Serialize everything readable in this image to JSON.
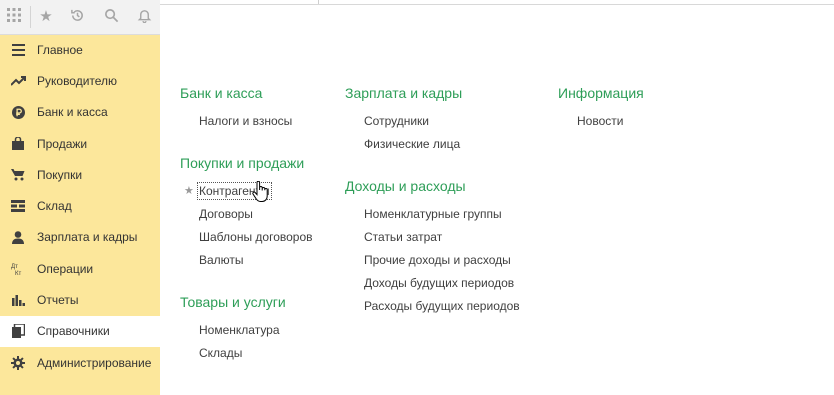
{
  "toolbar": {
    "icons": [
      "apps-grid-icon",
      "star-icon",
      "history-icon",
      "search-icon",
      "bell-icon"
    ]
  },
  "nav": {
    "items": [
      {
        "label": "Главное",
        "icon": "menu-lines-icon"
      },
      {
        "label": "Руководителю",
        "icon": "trend-up-icon"
      },
      {
        "label": "Банк и касса",
        "icon": "ruble-coin-icon"
      },
      {
        "label": "Продажи",
        "icon": "shopping-bag-icon"
      },
      {
        "label": "Покупки",
        "icon": "cart-icon"
      },
      {
        "label": "Склад",
        "icon": "warehouse-icon"
      },
      {
        "label": "Зарплата и кадры",
        "icon": "person-icon"
      },
      {
        "label": "Операции",
        "icon": "dt-kt-icon",
        "icon_text": "Дт\nКт"
      },
      {
        "label": "Отчеты",
        "icon": "bar-chart-icon"
      },
      {
        "label": "Справочники",
        "icon": "books-icon",
        "active": true
      },
      {
        "label": "Администрирование",
        "icon": "gear-icon"
      }
    ]
  },
  "sections": {
    "bank": {
      "title": "Банк и касса",
      "links": [
        "Налоги и взносы"
      ]
    },
    "purchases_sales": {
      "title": "Покупки и продажи",
      "links": [
        "Контрагенты",
        "Договоры",
        "Шаблоны договоров",
        "Валюты"
      ]
    },
    "goods": {
      "title": "Товары и услуги",
      "links": [
        "Номенклатура",
        "Склады"
      ]
    },
    "salary": {
      "title": "Зарплата и кадры",
      "links": [
        "Сотрудники",
        "Физические лица"
      ]
    },
    "income": {
      "title": "Доходы и расходы",
      "links": [
        "Номенклатурные группы",
        "Статьи затрат",
        "Прочие доходы и расходы",
        "Доходы будущих периодов",
        "Расходы будущих периодов"
      ]
    },
    "info": {
      "title": "Информация",
      "links": [
        "Новости"
      ]
    }
  },
  "colors": {
    "sidebar_bg": "#fce79b",
    "section_title": "#2e9e58",
    "active_bg": "#ffffff"
  }
}
